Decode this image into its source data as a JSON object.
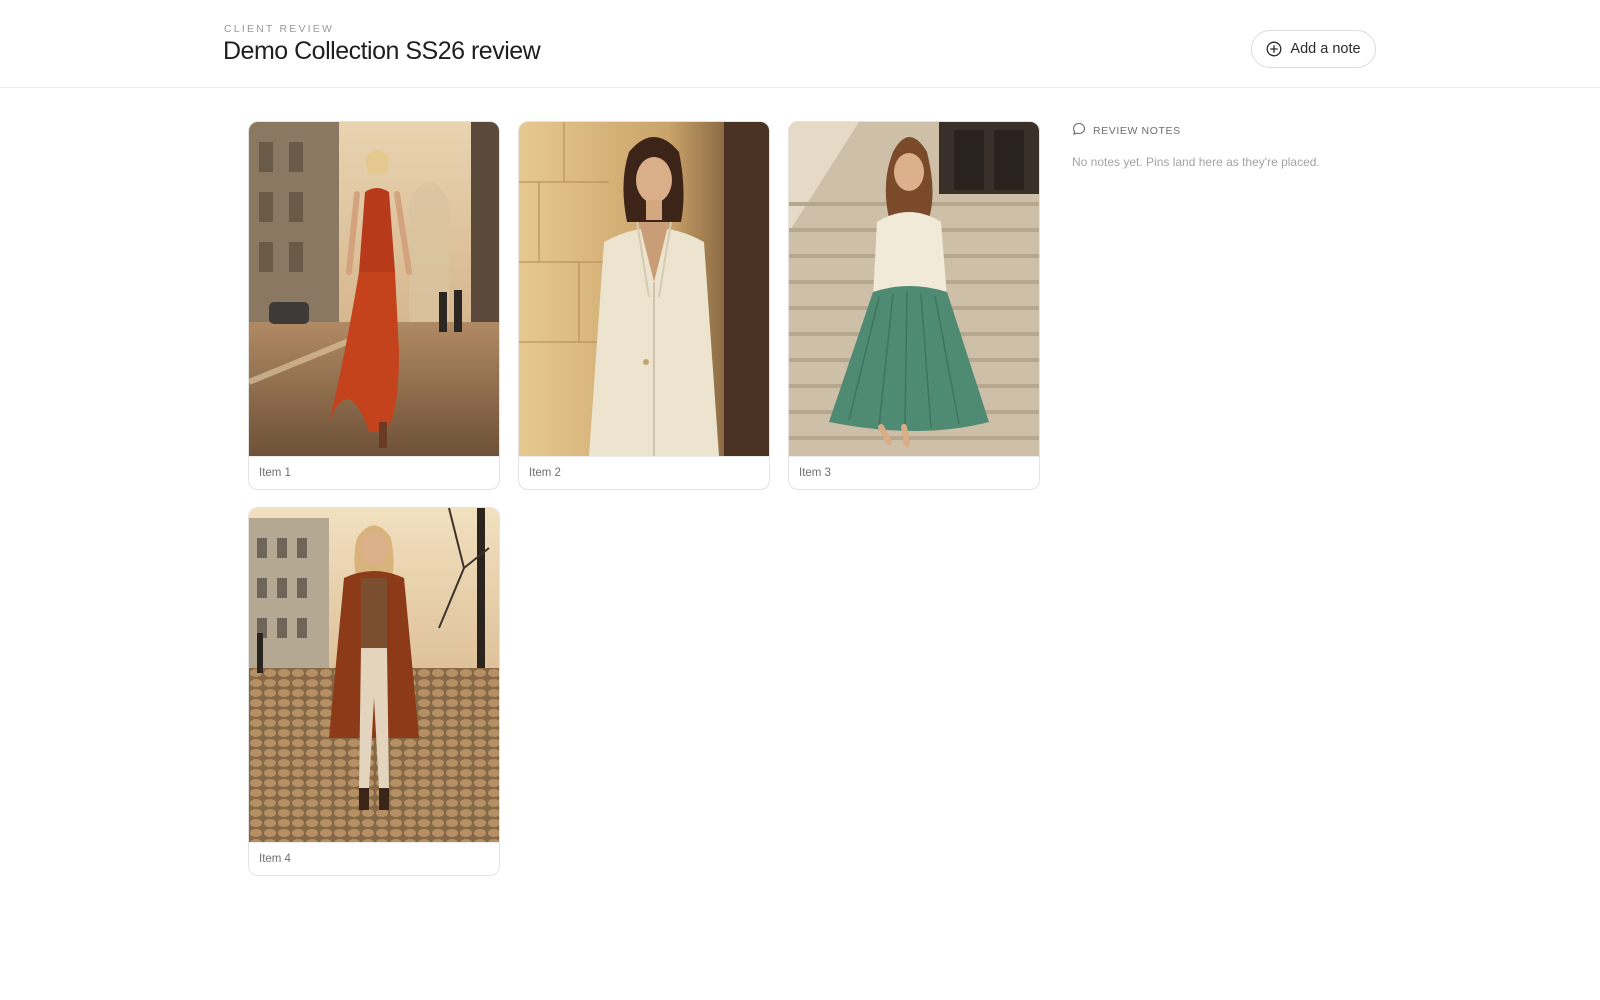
{
  "header": {
    "eyebrow": "CLIENT REVIEW",
    "title": "Demo Collection SS26 review",
    "add_note_label": "Add a note",
    "add_note_icon": "plus-circle-icon"
  },
  "items": [
    {
      "label": "Item 1",
      "scene": "woman in red flowing dress walking on sunlit city street",
      "accent": "#c2401c"
    },
    {
      "label": "Item 2",
      "scene": "woman in cream blazer leaning against stone wall",
      "accent": "#e9e3d3"
    },
    {
      "label": "Item 3",
      "scene": "woman in cream sweater and green pleated skirt sitting on stairs",
      "accent": "#4f8a73"
    },
    {
      "label": "Item 4",
      "scene": "woman in rust coat walking on cobblestone street",
      "accent": "#8c3a18"
    }
  ],
  "notes": {
    "heading": "REVIEW NOTES",
    "heading_icon": "speech-bubble-icon",
    "empty_text": "No notes yet. Pins land here as they're placed."
  }
}
